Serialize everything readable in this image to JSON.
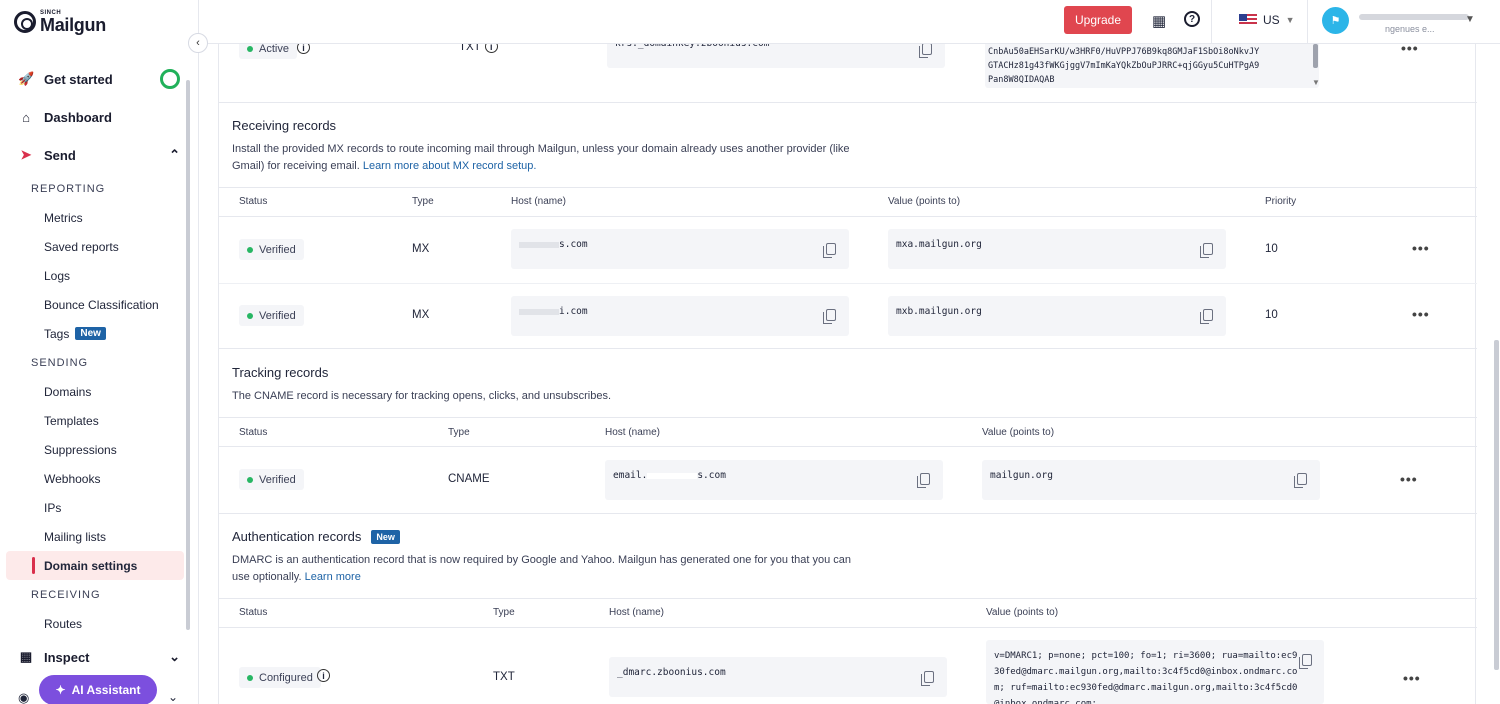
{
  "brand": {
    "sinch": "SINCH",
    "name": "Mailgun"
  },
  "sidebar": {
    "get_started": "Get started",
    "dashboard": "Dashboard",
    "send": "Send",
    "reporting_label": "REPORTING",
    "reporting_items": [
      "Metrics",
      "Saved reports",
      "Logs",
      "Bounce Classification",
      "Tags"
    ],
    "tags_badge": "New",
    "sending_label": "SENDING",
    "sending_items": [
      "Domains",
      "Templates",
      "Suppressions",
      "Webhooks",
      "IPs",
      "Mailing lists",
      "Domain settings"
    ],
    "receiving_label": "RECEIVING",
    "receiving_items": [
      "Routes"
    ],
    "inspect": "Inspect",
    "ai_assistant": "AI Assistant"
  },
  "topbar": {
    "upgrade": "Upgrade",
    "region": "US",
    "user_sub": "ngenues e..."
  },
  "dkim_row": {
    "status": "Active",
    "type": "TXT",
    "host": "krs._domainkey.zboonius.com",
    "value_lines": [
      "CnbAu50aEHSarKU/w3HRF0/HuVPPJ76B9kq8GMJaF1SbOi8oNkvJY",
      "GTACHz81g43fWKGjggV7mImKaYQkZbOuPJRRC+qjGGyu5CuHTPgA9",
      "Pan8W8QIDAQAB"
    ]
  },
  "receiving": {
    "title": "Receiving records",
    "desc": "Install the provided MX records to route incoming mail through Mailgun, unless your domain already uses another provider (like Gmail) for receiving email.",
    "link": "Learn more about MX record setup.",
    "headers": {
      "status": "Status",
      "type": "Type",
      "host": "Host (name)",
      "value": "Value (points to)",
      "priority": "Priority"
    },
    "rows": [
      {
        "status": "Verified",
        "type": "MX",
        "host": "s.com",
        "value": "mxa.mailgun.org",
        "priority": "10"
      },
      {
        "status": "Verified",
        "type": "MX",
        "host": "i.com",
        "value": "mxb.mailgun.org",
        "priority": "10"
      }
    ]
  },
  "tracking": {
    "title": "Tracking records",
    "desc": "The CNAME record is necessary for tracking opens, clicks, and unsubscribes.",
    "headers": {
      "status": "Status",
      "type": "Type",
      "host": "Host (name)",
      "value": "Value (points to)"
    },
    "row": {
      "status": "Verified",
      "type": "CNAME",
      "host_prefix": "email.",
      "host_suffix": "s.com",
      "value": "mailgun.org"
    }
  },
  "authentication": {
    "title": "Authentication records",
    "badge": "New",
    "desc": "DMARC is an authentication record that is now required by Google and Yahoo. Mailgun has generated one for you that you can use optionally.",
    "link": "Learn more",
    "headers": {
      "status": "Status",
      "type": "Type",
      "host": "Host (name)",
      "value": "Value (points to)"
    },
    "row": {
      "status": "Configured",
      "type": "TXT",
      "host": "_dmarc.zboonius.com",
      "value_lines": [
        "v=DMARC1; p=none; pct=100; fo=1; ri=3600; rua=mailto:ec9",
        "30fed@dmarc.mailgun.org,mailto:3c4f5cd0@inbox.ondmarc.co",
        "m; ruf=mailto:ec930fed@dmarc.mailgun.org,mailto:3c4f5cd0",
        "@inbox.ondmarc.com;"
      ]
    }
  },
  "colors": {
    "accent": "#e0464f",
    "link": "#1e63a6",
    "verified": "#27b663",
    "ai": "#7c4fde"
  }
}
